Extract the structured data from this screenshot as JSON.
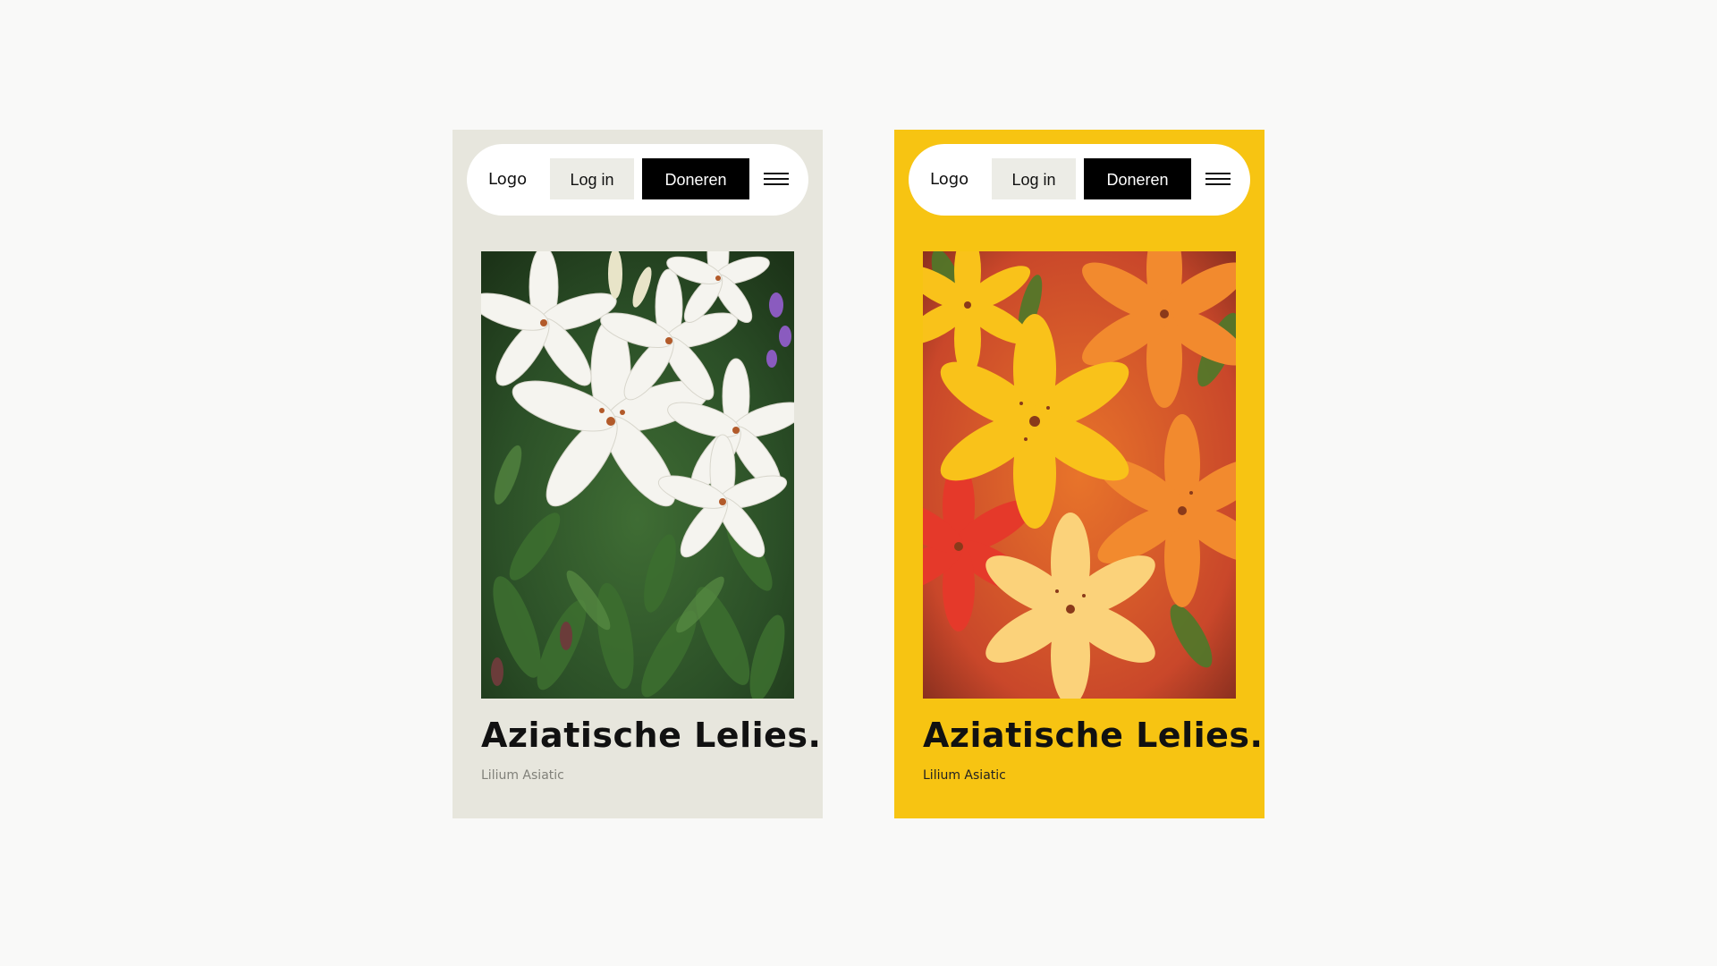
{
  "colors": {
    "page_background": "#f9f9f8",
    "card_left_background": "#e7e6dd",
    "card_right_background": "#f7c412",
    "navbar_background": "#ffffff",
    "login_button_background": "#ecece6",
    "donate_button_background": "#000000",
    "donate_button_text": "#ffffff"
  },
  "cards": [
    {
      "variant": "neutral",
      "nav": {
        "logo": "Logo",
        "login_label": "Log in",
        "donate_label": "Doneren",
        "menu_icon": "hamburger-icon"
      },
      "image": {
        "subject": "white-lilies-photo"
      },
      "title": "Aziatische Lelies.",
      "subtitle": "Lilium Asiatic"
    },
    {
      "variant": "yellow",
      "nav": {
        "logo": "Logo",
        "login_label": "Log in",
        "donate_label": "Doneren",
        "menu_icon": "hamburger-icon"
      },
      "image": {
        "subject": "orange-yellow-lilies-photo"
      },
      "title": "Aziatische Lelies.",
      "subtitle": "Lilium Asiatic"
    }
  ]
}
